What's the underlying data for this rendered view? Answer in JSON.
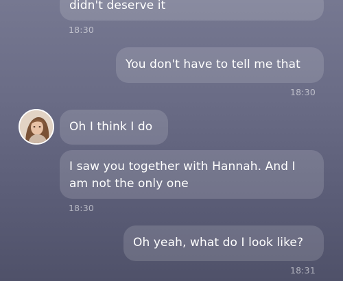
{
  "messages": [
    {
      "text": "didn't deserve it",
      "time": "18:30",
      "direction": "incoming"
    },
    {
      "text": "You don't have to tell me that",
      "time": "18:30",
      "direction": "outgoing"
    },
    {
      "text": "Oh I think I do",
      "direction": "incoming"
    },
    {
      "text": "I saw you together with Hannah. And I am not the only one",
      "time": "18:30",
      "direction": "incoming"
    },
    {
      "text": "Oh yeah, what do I look like?",
      "time": "18:31",
      "direction": "outgoing"
    }
  ],
  "colors": {
    "background_top": "#767891",
    "background_bottom": "#4f5169",
    "bubble": "rgba(255,255,255,0.14)",
    "text": "#ffffff",
    "timestamp": "rgba(255,255,255,0.55)"
  },
  "icons": {
    "contact_avatar": "avatar-photo"
  }
}
